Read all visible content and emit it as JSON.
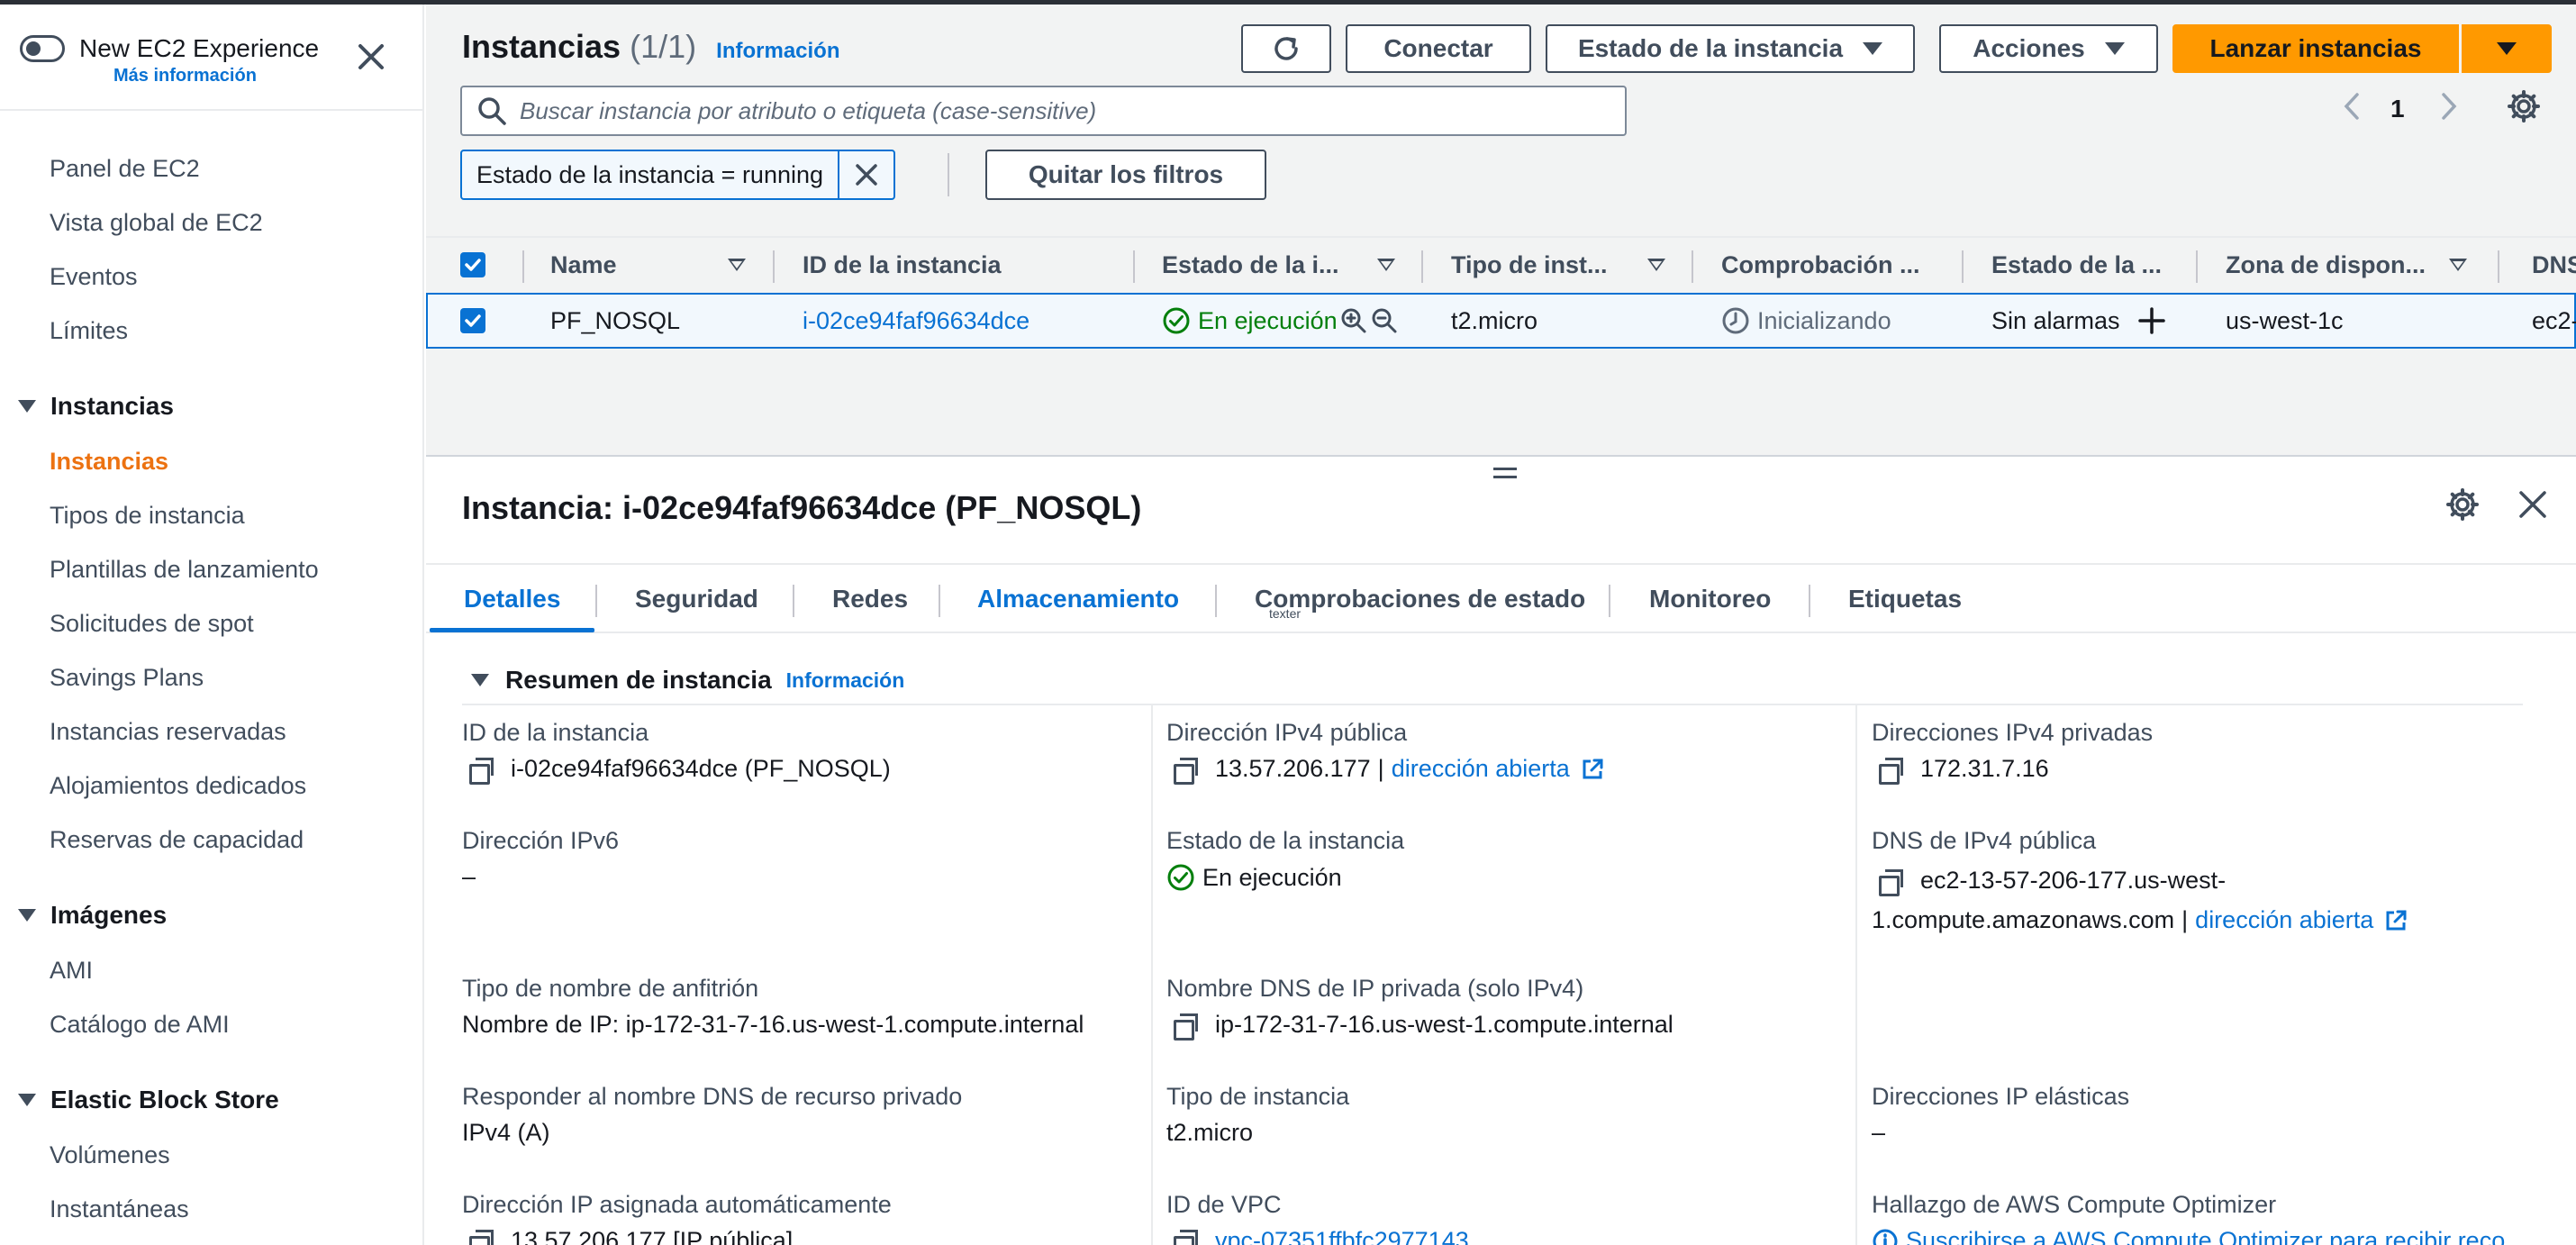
{
  "sidebar": {
    "experience_title": "New EC2 Experience",
    "experience_link": "Más información",
    "items_top": [
      "Panel de EC2",
      "Vista global de EC2",
      "Eventos",
      "Límites"
    ],
    "section_instances": "Instancias",
    "instances_items": [
      "Instancias",
      "Tipos de instancia",
      "Plantillas de lanzamiento",
      "Solicitudes de spot",
      "Savings Plans",
      "Instancias reservadas",
      "Alojamientos dedicados",
      "Reservas de capacidad"
    ],
    "section_images": "Imágenes",
    "images_items": [
      "AMI",
      "Catálogo de AMI"
    ],
    "section_ebs": "Elastic Block Store",
    "ebs_items": [
      "Volúmenes",
      "Instantáneas"
    ]
  },
  "header": {
    "title": "Instancias",
    "count": "(1/1)",
    "info": "Información",
    "connect": "Conectar",
    "instance_state": "Estado de la instancia",
    "actions": "Acciones",
    "launch": "Lanzar instancias"
  },
  "search": {
    "placeholder": "Buscar instancia por atributo o etiqueta (case-sensitive)",
    "page": "1"
  },
  "filter": {
    "token": "Estado de la instancia = running",
    "clear": "Quitar los filtros"
  },
  "table": {
    "columns": [
      "Name",
      "ID de la instancia",
      "Estado de la i...",
      "Tipo de inst...",
      "Comprobación ...",
      "Estado de la ...",
      "Zona de dispon...",
      "DNS"
    ],
    "row": {
      "name": "PF_NOSQL",
      "id": "i-02ce94faf96634dce",
      "state": "En ejecución",
      "type": "t2.micro",
      "check": "Inicializando",
      "alarm": "Sin alarmas",
      "zone": "us-west-1c",
      "dns": "ec2-"
    }
  },
  "details": {
    "title": "Instancia: i-02ce94faf96634dce (PF_NOSQL)",
    "tabs": [
      "Detalles",
      "Seguridad",
      "Redes",
      "Almacenamiento",
      "Comprobaciones de estado",
      "Monitoreo",
      "Etiquetas"
    ],
    "tab_tooltip": "texter",
    "section": "Resumen de instancia",
    "section_info": "Información",
    "col1": {
      "instance_id_label": "ID de la instancia",
      "instance_id_value": "i-02ce94faf96634dce (PF_NOSQL)",
      "ipv6_label": "Dirección IPv6",
      "ipv6_value": "–",
      "hostname_type_label": "Tipo de nombre de anfitrión",
      "hostname_type_value": "Nombre de IP: ip-172-31-7-16.us-west-1.compute.internal",
      "resp_dns_label": "Responder al nombre DNS de recurso privado",
      "resp_dns_value": "IPv4 (A)",
      "auto_ip_label": "Dirección IP asignada automáticamente",
      "auto_ip_value": "13.57.206.177 [IP pública]"
    },
    "col2": {
      "public_ipv4_label": "Dirección IPv4 pública",
      "public_ipv4_value": "13.57.206.177",
      "public_ipv4_sep": "|",
      "open_link": "dirección abierta",
      "state_label": "Estado de la instancia",
      "state_value": "En ejecución",
      "private_dns_label": "Nombre DNS de IP privada (solo IPv4)",
      "private_dns_value": "ip-172-31-7-16.us-west-1.compute.internal",
      "type_label": "Tipo de instancia",
      "type_value": "t2.micro",
      "vpc_label": "ID de VPC",
      "vpc_value": "vpc-07351ffbfc2977143"
    },
    "col3": {
      "private_ipv4_label": "Direcciones IPv4 privadas",
      "private_ipv4_value": "172.31.7.16",
      "public_dns_label": "DNS de IPv4 pública",
      "public_dns_value_1": "ec2-13-57-206-177.us-west-",
      "public_dns_value_2": "1.compute.amazonaws.com",
      "public_dns_sep": "|",
      "open_link": "dirección abierta",
      "eip_label": "Direcciones IP elásticas",
      "eip_value": "–",
      "optimizer_label": "Hallazgo de AWS Compute Optimizer",
      "optimizer_value": "Suscribirse a AWS Compute Optimizer para recibir reco"
    }
  },
  "colors": {
    "accent": "#0972d3",
    "primary_button": "#ff9900",
    "running": "#037f0c",
    "active_nav": "#ec7211"
  }
}
